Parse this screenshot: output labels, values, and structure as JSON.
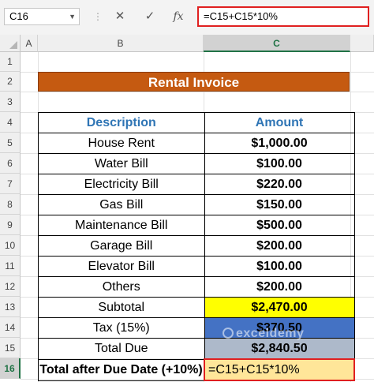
{
  "formula_bar": {
    "name_box": "C16",
    "separator": "⋮",
    "cancel_icon": "✕",
    "enter_icon": "✓",
    "fx_label": "fx",
    "formula": "=C15+C15*10%"
  },
  "columns": [
    "A",
    "B",
    "C"
  ],
  "rows": [
    "1",
    "2",
    "3",
    "4",
    "5",
    "6",
    "7",
    "8",
    "9",
    "10",
    "11",
    "12",
    "13",
    "14",
    "15",
    "16"
  ],
  "invoice": {
    "title": "Rental Invoice",
    "header": {
      "description": "Description",
      "amount": "Amount"
    },
    "items": [
      {
        "description": "House Rent",
        "amount": "$1,000.00"
      },
      {
        "description": "Water Bill",
        "amount": "$100.00"
      },
      {
        "description": "Electricity Bill",
        "amount": "$220.00"
      },
      {
        "description": "Gas Bill",
        "amount": "$150.00"
      },
      {
        "description": "Maintenance Bill",
        "amount": "$500.00"
      },
      {
        "description": "Garage Bill",
        "amount": "$200.00"
      },
      {
        "description": "Elevator Bill",
        "amount": "$100.00"
      },
      {
        "description": "Others",
        "amount": "$200.00"
      }
    ],
    "subtotal": {
      "description": "Subtotal",
      "amount": "$2,470.00"
    },
    "tax": {
      "description": "Tax (15%)",
      "amount": "$370.50"
    },
    "total_due": {
      "description": "Total Due",
      "amount": "$2,840.50"
    },
    "after_due": {
      "description": "Total after Due Date (+10%)",
      "amount": "=C15+C15*10%"
    }
  },
  "watermark": "exceldemy",
  "colors": {
    "title_bg": "#c55a11",
    "header_text": "#2f75b5",
    "subtotal_bg": "#ffff00",
    "tax_bg": "#4472c4",
    "total_bg": "#adb9ca",
    "active_bg": "#ffe699",
    "highlight_border": "#e02020"
  }
}
